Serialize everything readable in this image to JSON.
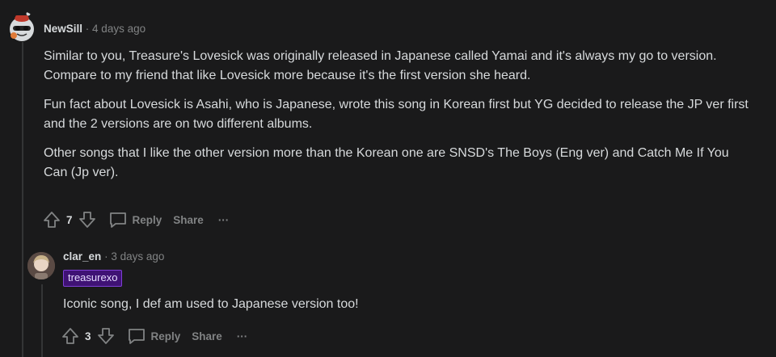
{
  "comment1": {
    "author": "NewSill",
    "separator": "·",
    "time": "4 days ago",
    "paragraphs": [
      "Similar to you, Treasure's Lovesick was originally released in Japanese called Yamai and it's always my go to version. Compare to my friend that like Lovesick more because it's the first version she heard.",
      "Fun fact about Lovesick is Asahi, who is Japanese, wrote this song in Korean first but YG decided to release the JP ver first and the 2 versions are on two different albums.",
      "Other songs that I like the other version more than the Korean one are SNSD's The Boys (Eng ver) and Catch Me If You Can (Jp ver)."
    ],
    "score": "7",
    "reply_label": "Reply",
    "share_label": "Share",
    "more_label": "···"
  },
  "comment2": {
    "author": "clar_en",
    "separator": "·",
    "time": "3 days ago",
    "flair": "treasurexo",
    "text": "Iconic song, I def am used to Japanese version too!",
    "score": "3",
    "reply_label": "Reply",
    "share_label": "Share",
    "more_label": "···"
  },
  "colors": {
    "background": "#1a1a1b",
    "text": "#d7dadc",
    "muted": "#818384",
    "flair_bg": "#3f1274"
  },
  "icons": [
    "snoo-avatar-icon",
    "user-avatar-icon",
    "upvote-icon",
    "downvote-icon",
    "comment-bubble-icon",
    "more-options-icon"
  ]
}
